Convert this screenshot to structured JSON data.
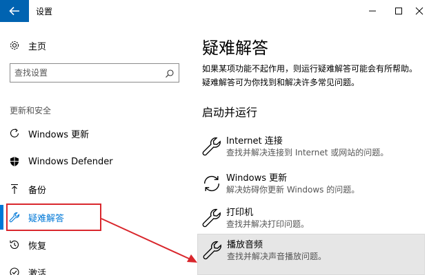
{
  "window": {
    "title": "设置",
    "controls": [
      "minimize",
      "maximize",
      "close"
    ]
  },
  "sidebar": {
    "home_label": "主页",
    "search_placeholder": "查找设置",
    "section_title": "更新和安全",
    "items": [
      {
        "label": "Windows 更新",
        "icon": "refresh-icon"
      },
      {
        "label": "Windows Defender",
        "icon": "shield-icon"
      },
      {
        "label": "备份",
        "icon": "upload-icon"
      },
      {
        "label": "疑难解答",
        "icon": "wrench-icon",
        "selected": true
      },
      {
        "label": "恢复",
        "icon": "history-icon"
      },
      {
        "label": "激活",
        "icon": "check-circle-icon"
      }
    ]
  },
  "main": {
    "title": "疑难解答",
    "description": "如果某项功能不起作用，则运行疑难解答可能会有所帮助。疑难解答可为你找到和解决许多常见问题。",
    "section_title": "启动并运行",
    "items": [
      {
        "title": "Internet 连接",
        "subtitle": "查找并解决连接到 Internet 或网站的问题。",
        "icon": "wrench-icon"
      },
      {
        "title": "Windows 更新",
        "subtitle": "解决妨碍你更新 Windows 的问题。",
        "icon": "refresh-icon"
      },
      {
        "title": "打印机",
        "subtitle": "查找并解决打印问题。",
        "icon": "wrench-icon"
      },
      {
        "title": "播放音频",
        "subtitle": "查找并解决声音播放问题。",
        "icon": "wrench-icon",
        "highlighted": true
      }
    ]
  },
  "colors": {
    "accent": "#0078d7",
    "back_button": "#0063b1",
    "annotation": "#d9262c",
    "highlight_bg": "#e6e6e6"
  }
}
